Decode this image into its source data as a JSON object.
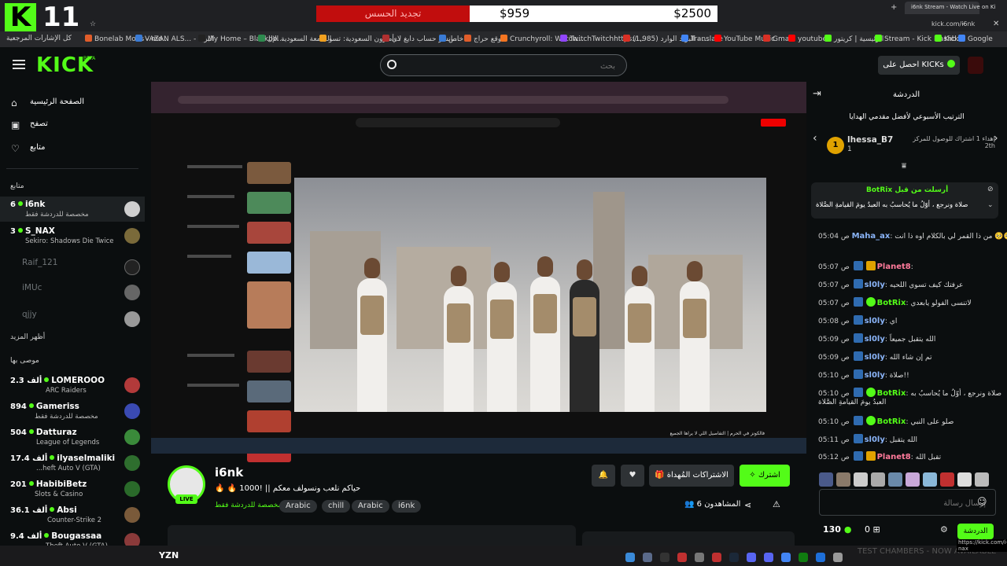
{
  "overlay": {
    "logo_letter": "K",
    "logo_number": "11",
    "bar_red_label": "تجديد الحسس",
    "bar_amount_current": "$959",
    "bar_amount_goal": "$2500"
  },
  "browser": {
    "active_tab_title": "i6nk Stream - Watch Live on Ki",
    "url": "kick.com/i6nk",
    "bookmarks": [
      {
        "label": "كل الإشارات المرجعية",
        "color": "#888"
      },
      {
        "label": "Bonelab Mods - mo...",
        "color": "#e05d2a"
      },
      {
        "label": "VAZAN ALS... - البريد",
        "color": "#3a7bd5"
      },
      {
        "label": "My Home – Blackbo...",
        "color": "#222"
      },
      {
        "label": "الجامعة السعودية الإل...",
        "color": "#2d8a4e"
      },
      {
        "label": "أمازون السعودية: تسو...",
        "color": "#f0a020"
      },
      {
        "label": "انشر حساب دايغ لاي...",
        "color": "#b03030"
      },
      {
        "label": "خاص",
        "color": "#3a7bd5"
      },
      {
        "label": "موقع حراج",
        "color": "#e05d2a"
      },
      {
        "label": "Crunchyroll: Watch...",
        "color": "#f47521"
      },
      {
        "label": "TwitchTwitchhttps:/...",
        "color": "#9146ff"
      },
      {
        "label": "(1,985) البريد الوارد - ...",
        "color": "#d93025"
      },
      {
        "label": "Translate",
        "color": "#4285f4"
      },
      {
        "label": "YouTube Music",
        "color": "#ff0000"
      },
      {
        "label": "Gmail",
        "color": "#d93025"
      },
      {
        "label": "youtube",
        "color": "#ff0000"
      },
      {
        "label": "الرئيسية | كريتور",
        "color": "#53fc18"
      },
      {
        "label": "Stream - Kick Dashb...",
        "color": "#53fc18"
      },
      {
        "label": "Kick",
        "color": "#53fc18"
      },
      {
        "label": "Google",
        "color": "#4285f4"
      }
    ]
  },
  "header": {
    "brand": "KICK",
    "beta": "BETA",
    "search_placeholder": "بحث",
    "get_kicks": "احصل على KICKs"
  },
  "sidebar": {
    "nav": [
      {
        "label": "الصفحة الرئيسية",
        "icon": "home-icon"
      },
      {
        "label": "تصفح",
        "icon": "browse-icon"
      },
      {
        "label": "متابع",
        "icon": "heart-icon"
      }
    ],
    "following_heading": "متابع",
    "following": [
      {
        "count": "6",
        "name": "i6nk",
        "category": "مخصصة للدردشة فقط",
        "live": true,
        "avatar": "#cfcfcf"
      },
      {
        "count": "3",
        "name": "S_NAX",
        "category": "Sekiro: Shadows Die Twice",
        "live": true,
        "avatar": "#7a6a3a"
      },
      {
        "count": "",
        "name": "Raif_121",
        "category": "",
        "live": false,
        "avatar": "#222"
      },
      {
        "count": "",
        "name": "iMUc",
        "category": "",
        "live": false,
        "avatar": "#666"
      },
      {
        "count": "",
        "name": "qjjy",
        "category": "",
        "live": false,
        "avatar": "#999"
      }
    ],
    "show_more": "أظهر المزيد",
    "recommended_heading": "موصى بها",
    "recommended": [
      {
        "count": "2.3 ألف",
        "name": "LOMEROOO",
        "category": "ARC Raiders",
        "avatar": "#b23a3a"
      },
      {
        "count": "894",
        "name": "Gameriss",
        "category": "مخصصة للدردشة فقط",
        "avatar": "#3a4ab2"
      },
      {
        "count": "504",
        "name": "Datturaz",
        "category": "League of Legends",
        "avatar": "#3a8a3a"
      },
      {
        "count": "17.4 ألف",
        "name": "ilyaselmaliki",
        "category": "...heft Auto V (GTA)",
        "avatar": "#2e6e2e"
      },
      {
        "count": "201",
        "name": "HabibiBetz",
        "category": "Slots & Casino",
        "avatar": "#2a6a2a"
      },
      {
        "count": "36.1 ألف",
        "name": "Absi",
        "category": "Counter-Strike 2",
        "avatar": "#7a5a3a"
      },
      {
        "count": "9.4 ألف",
        "name": "Bougassaa",
        "category": "Theft Auto V (GTA)",
        "avatar": "#8a3a3a"
      }
    ]
  },
  "stream": {
    "streamer": "i6nk",
    "live_label": "LIVE",
    "title": "🔥 🔥 1000! || حياكم نلعب ونسولف معكم",
    "category": "مخصصة للدردشة فقط",
    "tags": [
      "Arabic",
      "chill",
      "Arabic",
      "i6nk"
    ],
    "subscribe_label": "اشترك",
    "gift_label": "الاشتراكات المُهداة",
    "viewers_label": "المشاهدون 6",
    "video_caption": "فالكونز في الحرم | التفاصيل اللي لا يراها الجميع",
    "bottom_left_text": "YZN"
  },
  "chat": {
    "title": "الدردشة",
    "leaderboard_title": "الترتيب الأسبوعي لأفضل مقدمي الهدايا",
    "leader_rank": "1",
    "leader_name": "lhessa_B7",
    "leader_gifts": "1",
    "next_label": "إهداء 1 اشتراك للوصول للمركز 2th",
    "pinned_by": "BotRix أرسلت من قبل",
    "pinned_text": "صلاة ونرجع ، أوّلُ ما يُحاسبُ به العبدُ يومَ القيامةِ الصَّلاة",
    "messages": [
      {
        "time": "05:04 ص",
        "user": "Maha_ax",
        "color": "#8ab4f8",
        "text": ": من ذا القمر لي بالكلام اوه ذا انت 🥺🥺🥺"
      },
      {
        "time": "05:07 ص",
        "user": "Planet8",
        "color": "#ff7a9a",
        "text": ":"
      },
      {
        "time": "05:07 ص",
        "user": "sl0ly",
        "color": "#8ab4f8",
        "text": ": عرفتك كيف تسوي اللحيه"
      },
      {
        "time": "05:07 ص",
        "user": "BotRix",
        "color": "#53fc18",
        "text": ": لاتنسى الفولو يابعدي"
      },
      {
        "time": "05:08 ص",
        "user": "sl0ly",
        "color": "#8ab4f8",
        "text": ": اي"
      },
      {
        "time": "05:09 ص",
        "user": "sl0ly",
        "color": "#8ab4f8",
        "text": ": الله يتقبل جميعاً"
      },
      {
        "time": "05:09 ص",
        "user": "sl0ly",
        "color": "#8ab4f8",
        "text": ": تم إن شاء الله"
      },
      {
        "time": "05:10 ص",
        "user": "sl0ly",
        "color": "#8ab4f8",
        "text": ": صلاة!!"
      },
      {
        "time": "05:10 ص",
        "user": "BotRix",
        "color": "#53fc18",
        "text": ": صلاة ونرجع ، أوّلُ ما يُحاسبُ به"
      },
      {
        "time": "",
        "user": "",
        "color": "#ddd",
        "text": "العبدُ يومَ القيامةِ الصَّلاة"
      },
      {
        "time": "05:10 ص",
        "user": "BotRix",
        "color": "#53fc18",
        "text": ": صلو على النبي"
      },
      {
        "time": "05:11 ص",
        "user": "sl0ly",
        "color": "#8ab4f8",
        "text": ": الله يتقبل"
      },
      {
        "time": "05:12 ص",
        "user": "Planet8",
        "color": "#ff7a9a",
        "text": ": تقبل الله"
      }
    ],
    "input_placeholder": "إرسال رسالة",
    "kicks_count": "130",
    "points_count": "0",
    "send_label": "الدردشة"
  },
  "taskbar": {
    "overlay_text": "TEST CHAMBERS - NOW AVAILABLE",
    "status_link": "https://kick.com/i-nax"
  }
}
